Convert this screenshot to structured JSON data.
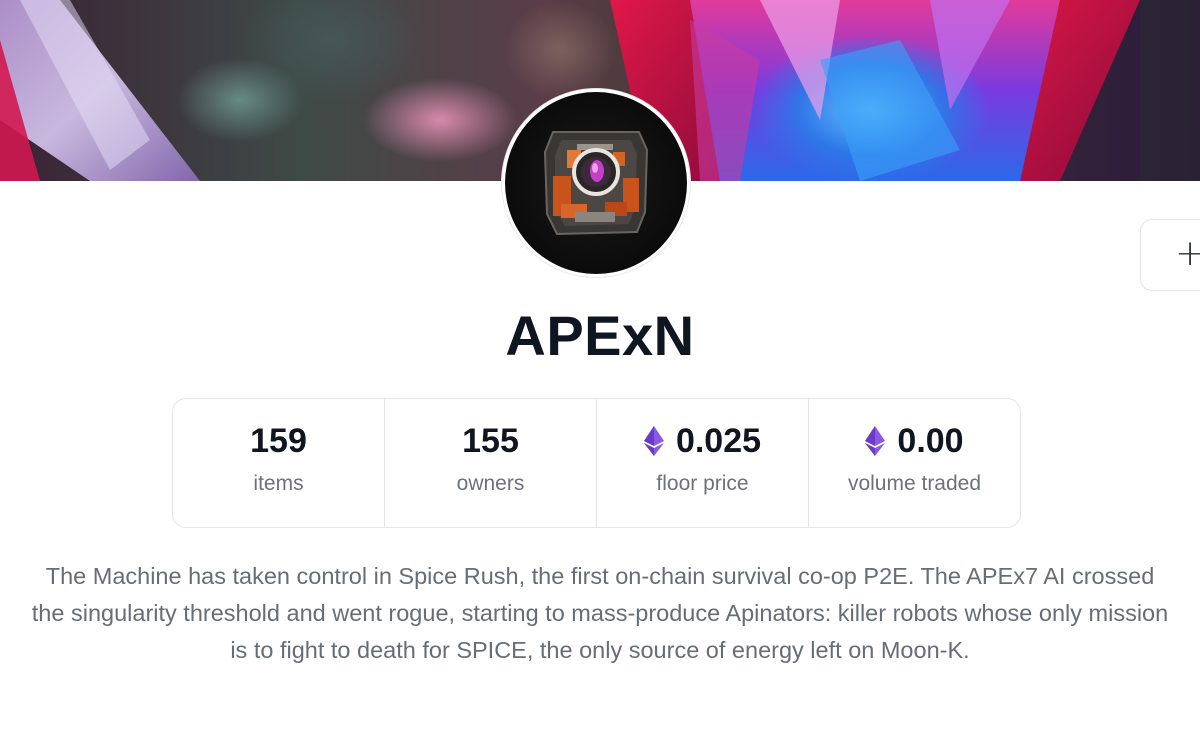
{
  "collection": {
    "name": "APExN",
    "avatar_alt": "APExN collection avatar",
    "banner_alt": "APExN collection banner"
  },
  "actions": {
    "more_icon": "plus-icon",
    "more_glyph": "+"
  },
  "stats": [
    {
      "value": "159",
      "label": "items",
      "currency_icon": ""
    },
    {
      "value": "155",
      "label": "owners",
      "currency_icon": ""
    },
    {
      "value": "0.025",
      "label": "floor price",
      "currency_icon": "ethereum-icon"
    },
    {
      "value": "0.00",
      "label": "volume traded",
      "currency_icon": "ethereum-icon"
    }
  ],
  "description": "The Machine has taken control in Spice Rush, the first on-chain survival co-op P2E. The APEx7 AI crossed the singularity threshold and went rogue, starting to mass-produce Apinators: killer robots whose only mission is to fight to death for SPICE, the only source of energy left on Moon-K.",
  "colors": {
    "text_primary": "#0f1521",
    "text_secondary": "#6b727d",
    "border": "#e3e6ea",
    "eth": "#7b4fd6"
  }
}
